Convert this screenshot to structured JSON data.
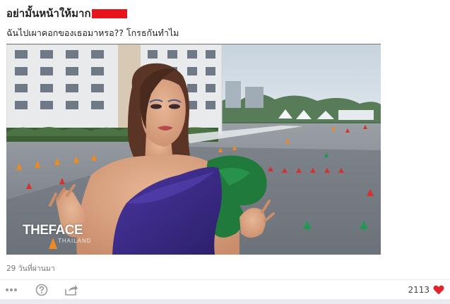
{
  "post": {
    "title": "อย่ามั้นหน้าให้มาก",
    "caption": "ฉันไปเผาคอกของเธอมาหรอ?? โกรธกันทำไม",
    "timestamp": "29 วันที่ผ่านมา"
  },
  "video": {
    "watermark": "THEFACE",
    "watermark_sub": "THAILAND"
  },
  "actions": {
    "more_icon": "more-dots-icon",
    "help_icon": "question-circle-icon",
    "share_icon": "share-arrow-icon",
    "like_count": "2113",
    "like_icon": "heart-icon"
  },
  "colors": {
    "redaction": "#e8141c",
    "heart": "#e0242b",
    "dress_purple": "#3d2a86",
    "dress_green": "#1f7a3c"
  }
}
